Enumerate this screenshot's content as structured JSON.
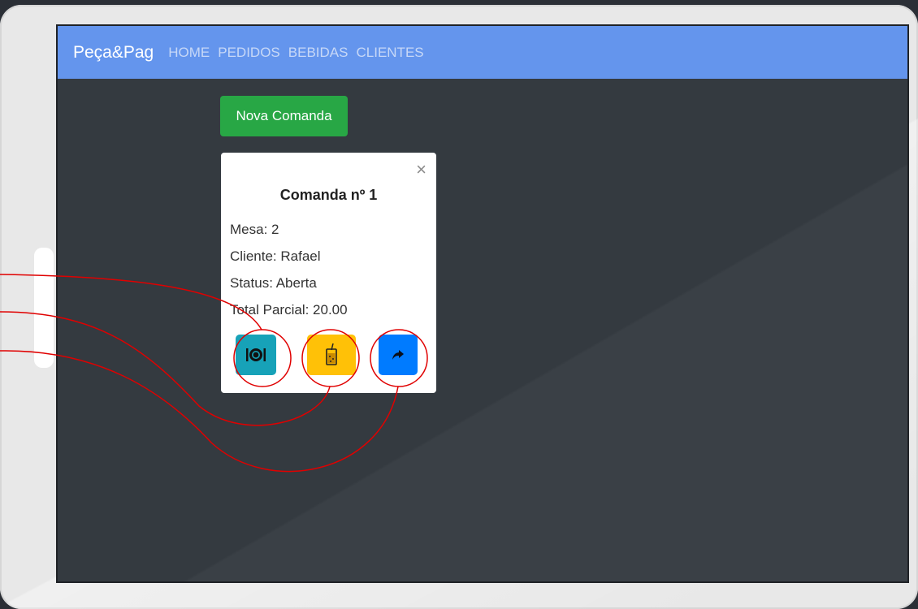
{
  "navbar": {
    "brand": "Peça&Pag",
    "links": [
      "HOME",
      "PEDIDOS",
      "BEBIDAS",
      "CLIENTES"
    ]
  },
  "new_order_button": "Nova Comanda",
  "card": {
    "close": "×",
    "title": "Comanda nº 1",
    "lines": [
      "Mesa: 2",
      "Cliente: Rafael",
      "Status: Aberta",
      "Total Parcial: 20.00"
    ]
  },
  "actions": [
    {
      "icon": "plate-cutlery-icon",
      "color": "#17a2b8"
    },
    {
      "icon": "drink-icon",
      "color": "#ffc107"
    },
    {
      "icon": "share-arrow-icon",
      "color": "#007bff"
    }
  ],
  "colors": {
    "navbar": "#6495ed",
    "screen": "#343a40",
    "success": "#28a745",
    "annotation": "#e00000"
  }
}
